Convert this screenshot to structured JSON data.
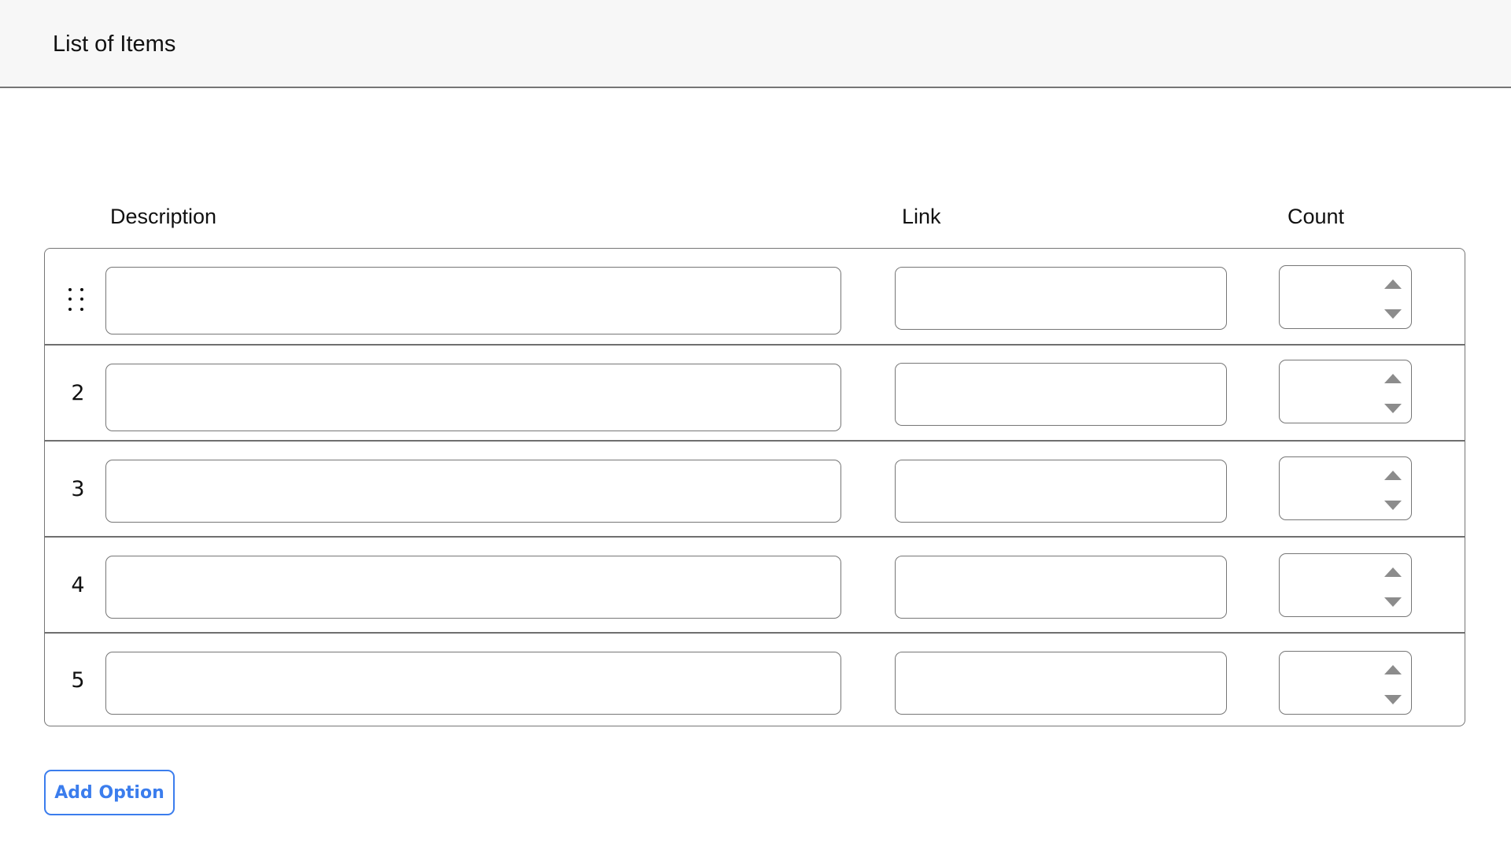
{
  "header": {
    "title": "List of Items"
  },
  "columns": {
    "description": "Description",
    "link": "Link",
    "count": "Count"
  },
  "rows": [
    {
      "index": "",
      "handle": "drag-handle-icon",
      "description": "",
      "link": "",
      "count": ""
    },
    {
      "index": "2",
      "description": "",
      "link": "",
      "count": ""
    },
    {
      "index": "3",
      "description": "",
      "link": "",
      "count": ""
    },
    {
      "index": "4",
      "description": "",
      "link": "",
      "count": ""
    },
    {
      "index": "5",
      "description": "",
      "link": "",
      "count": ""
    }
  ],
  "actions": {
    "add_option_label": "Add Option"
  },
  "colors": {
    "accent": "#3b7ded",
    "border": "#767676",
    "header_bg": "#f7f7f7",
    "spinner_arrow": "#8c8c8c"
  }
}
